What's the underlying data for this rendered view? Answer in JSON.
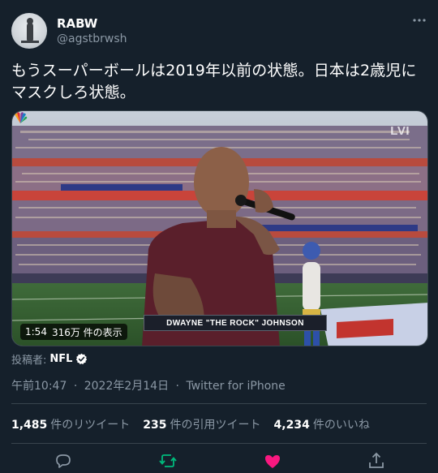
{
  "author": {
    "display_name": "RABW",
    "handle": "@agstbrwsh"
  },
  "tweet": {
    "text": "もうスーパーボールは2019年以前の状態。日本は2歳児にマスクしろ状態。"
  },
  "media": {
    "network_logo": "LVI",
    "lower_third": "DWAYNE \"THE ROCK\" JOHNSON",
    "duration": "1:54",
    "views": "316万 件の表示"
  },
  "contributed": {
    "label": "投稿者:",
    "name": "NFL"
  },
  "meta": {
    "time": "午前10:47",
    "date": "2022年2月14日",
    "source": "Twitter for iPhone"
  },
  "stats": [
    {
      "num": "1,485",
      "label": "件のリツイート"
    },
    {
      "num": "235",
      "label": "件の引用ツイート"
    },
    {
      "num": "4,234",
      "label": "件のいいね"
    }
  ],
  "colors": {
    "background": "#15202b",
    "secondary_text": "#8b98a5",
    "border": "#38444d",
    "retweet": "#00ba7c",
    "like": "#f91880",
    "verified": "#ffffff"
  },
  "icons": {
    "more": "more-icon",
    "verified": "verified-badge-icon",
    "reply": "reply-icon",
    "retweet": "retweet-icon",
    "like": "like-icon",
    "share": "share-icon"
  }
}
